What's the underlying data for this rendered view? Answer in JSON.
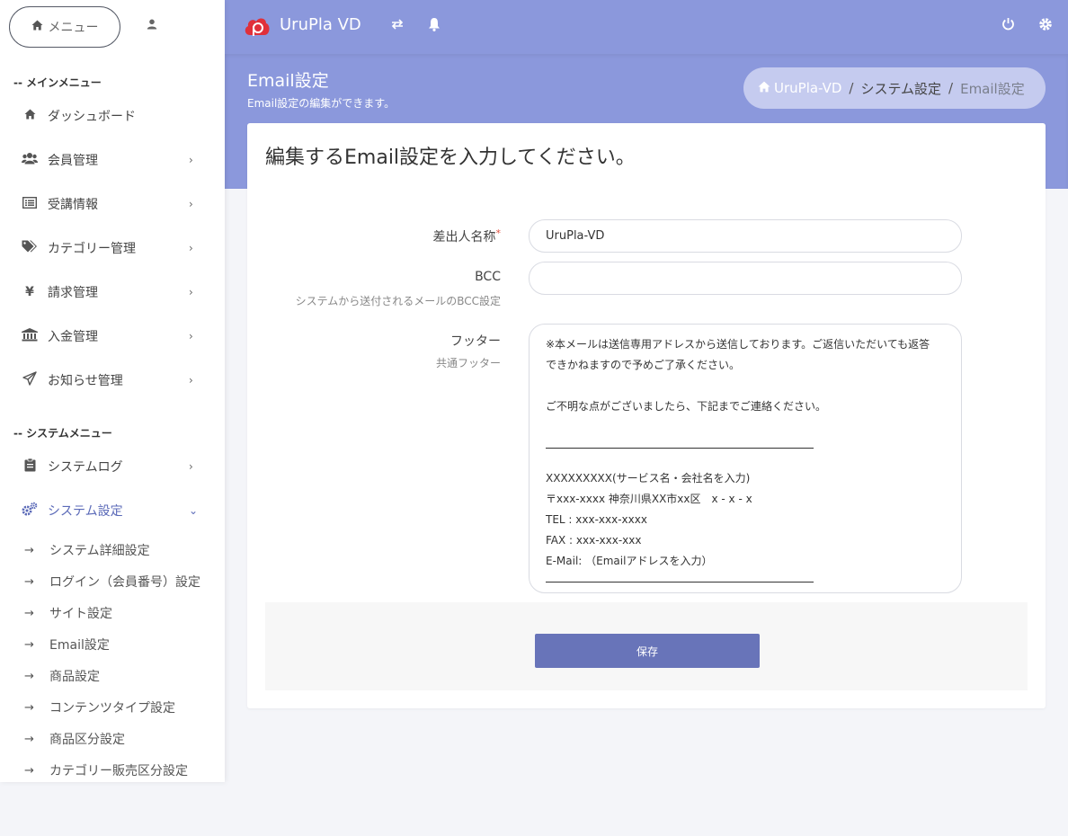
{
  "sidebar": {
    "menu_button": "メニュー",
    "main_section": "-- メインメニュー",
    "system_section": "-- システムメニュー",
    "main_items": [
      {
        "label": "ダッシュボード",
        "icon": "home-icon"
      },
      {
        "label": "会員管理",
        "icon": "users-icon"
      },
      {
        "label": "受講情報",
        "icon": "list-icon"
      },
      {
        "label": "カテゴリー管理",
        "icon": "tags-icon"
      },
      {
        "label": "請求管理",
        "icon": "yen-icon"
      },
      {
        "label": "入金管理",
        "icon": "bank-icon"
      },
      {
        "label": "お知らせ管理",
        "icon": "paper-plane-icon"
      }
    ],
    "system_items": [
      {
        "label": "システムログ",
        "icon": "clipboard-icon"
      },
      {
        "label": "システム設定",
        "icon": "cogs-icon"
      }
    ],
    "sub_items": [
      "システム詳細設定",
      "ログイン（会員番号）設定",
      "サイト設定",
      "Email設定",
      "商品設定",
      "コンテンツタイプ設定",
      "商品区分設定",
      "カテゴリー販売区分設定"
    ]
  },
  "topbar": {
    "brand": "UruPla VD",
    "accent": "#8b98dc"
  },
  "header": {
    "title": "Email設定",
    "subtitle": "Email設定の編集ができます。",
    "breadcrumb": {
      "home": "UruPla-VD",
      "middle": "システム設定",
      "current": "Email設定",
      "separator": "/"
    }
  },
  "form": {
    "heading": "編集するEmail設定を入力してください。",
    "sender_label": "差出人名称",
    "required_mark": "*",
    "sender_value": "UruPla-VD",
    "bcc_label": "BCC",
    "bcc_help": "システムから送付されるメールのBCC設定",
    "bcc_value": "",
    "footer_label": "フッター",
    "footer_help": "共通フッター",
    "footer_lines": [
      "※本メールは送信専用アドレスから送信しております。ご返信いただいても返答",
      "できかねますので予めご了承ください。",
      "",
      "ご不明な点がございましたら、下記までご連絡ください。",
      "",
      "—rule—",
      "XXXXXXXXX(サービス名・会社名を入力)",
      "〒xxx-xxxx 神奈川県XX市xx区　x - x - x",
      "TEL : xxx-xxx-xxxx",
      "FAX : xxx-xxx-xxx",
      "E-Mail: （Emailアドレスを入力）",
      "—rule—"
    ],
    "save_label": "保存",
    "save_color": "#6874b9"
  }
}
